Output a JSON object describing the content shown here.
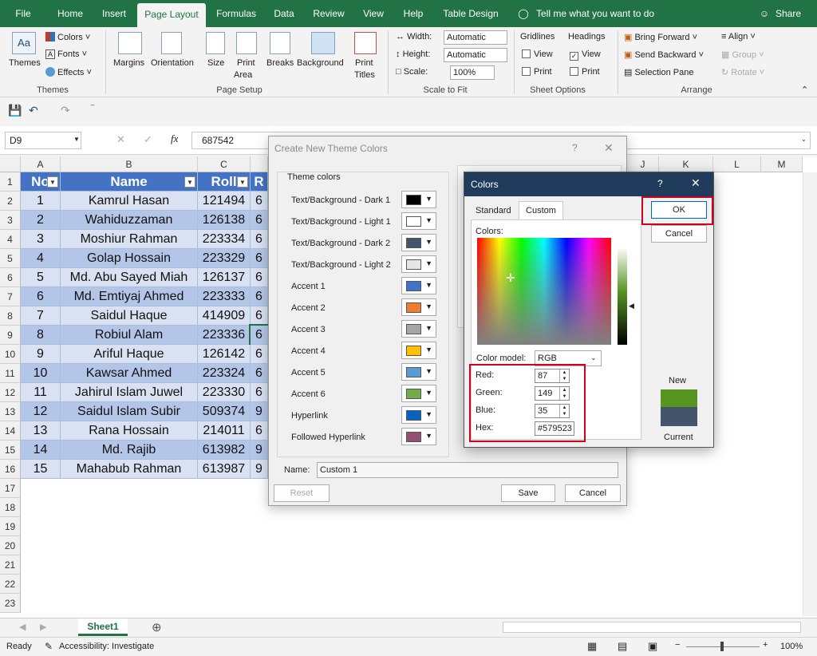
{
  "tabs": [
    {
      "label": "File"
    },
    {
      "label": "Home"
    },
    {
      "label": "Insert"
    },
    {
      "label": "Page Layout"
    },
    {
      "label": "Formulas"
    },
    {
      "label": "Data"
    },
    {
      "label": "Review"
    },
    {
      "label": "View"
    },
    {
      "label": "Help"
    },
    {
      "label": "Table Design"
    }
  ],
  "tell_me": "Tell me what you want to do",
  "share": "Share",
  "ribbon": {
    "themes": {
      "big": "Themes",
      "colors": "Colors",
      "fonts": "Fonts",
      "effects": "Effects",
      "group": "Themes"
    },
    "page_setup": {
      "margins": "Margins",
      "orientation": "Orientation",
      "size": "Size",
      "print_area_1": "Print",
      "print_area_2": "Area",
      "breaks": "Breaks",
      "background": "Background",
      "print_titles_1": "Print",
      "print_titles_2": "Titles",
      "group": "Page Setup"
    },
    "scale": {
      "width_label": "Width:",
      "width_value": "Automatic",
      "height_label": "Height:",
      "height_value": "Automatic",
      "scale_label": "Scale:",
      "scale_value": "100%",
      "group": "Scale to Fit"
    },
    "sheet_options": {
      "gridlines": "Gridlines",
      "headings": "Headings",
      "view": "View",
      "print": "Print",
      "group": "Sheet Options"
    },
    "arrange": {
      "bring_forward": "Bring Forward",
      "send_backward": "Send Backward",
      "selection_pane": "Selection Pane",
      "align": "Align",
      "group_btn": "Group",
      "rotate": "Rotate",
      "group": "Arrange"
    }
  },
  "formula_bar": {
    "name_box": "D9",
    "fx": "fx",
    "value": "687542"
  },
  "columns": [
    "A",
    "B",
    "C",
    "J",
    "K",
    "L",
    "M"
  ],
  "rows": [
    "1",
    "2",
    "3",
    "4",
    "5",
    "6",
    "7",
    "8",
    "9",
    "10",
    "11",
    "12",
    "13",
    "14",
    "15",
    "16",
    "17",
    "18",
    "19",
    "20",
    "21",
    "22",
    "23"
  ],
  "table": {
    "headers": [
      "No",
      "Name",
      "Roll",
      "R"
    ],
    "rows": [
      [
        "1",
        "Kamrul Hasan",
        "121494"
      ],
      [
        "2",
        "Wahiduzzaman",
        "126138"
      ],
      [
        "3",
        "Moshiur Rahman",
        "223334"
      ],
      [
        "4",
        "Golap Hossain",
        "223329"
      ],
      [
        "5",
        "Md. Abu Sayed Miah",
        "126137"
      ],
      [
        "6",
        "Md. Emtiyaj Ahmed",
        "223333"
      ],
      [
        "7",
        "Saidul Haque",
        "414909"
      ],
      [
        "8",
        "Robiul Alam",
        "223336"
      ],
      [
        "9",
        "Ariful Haque",
        "126142"
      ],
      [
        "10",
        "Kawsar Ahmed",
        "223324"
      ],
      [
        "11",
        "Jahirul Islam Juwel",
        "223330"
      ],
      [
        "12",
        "Saidul Islam Subir",
        "509374"
      ],
      [
        "13",
        "Rana Hossain",
        "214011"
      ],
      [
        "14",
        "Md. Rajib",
        "613982"
      ],
      [
        "15",
        "Mahabub Rahman",
        "613987"
      ]
    ],
    "col_d_partial": [
      "6",
      "6",
      "6",
      "6",
      "6",
      "6",
      "6",
      "6",
      "6",
      "6",
      "6",
      "9",
      "6",
      "9",
      "9"
    ]
  },
  "sheet_tab": "Sheet1",
  "status": {
    "ready": "Ready",
    "accessibility": "Accessibility: Investigate",
    "zoom": "100%"
  },
  "theme_dialog": {
    "title": "Create New Theme Colors",
    "help": "?",
    "group_label": "Theme colors",
    "items": [
      {
        "label": "Text/Background - Dark 1",
        "color": "#000000"
      },
      {
        "label": "Text/Background - Light 1",
        "color": "#ffffff"
      },
      {
        "label": "Text/Background - Dark 2",
        "color": "#44546a"
      },
      {
        "label": "Text/Background - Light 2",
        "color": "#e7e6e6"
      },
      {
        "label": "Accent 1",
        "color": "#4472c4"
      },
      {
        "label": "Accent 2",
        "color": "#ed7d31"
      },
      {
        "label": "Accent 3",
        "color": "#a5a5a5"
      },
      {
        "label": "Accent 4",
        "color": "#ffc000"
      },
      {
        "label": "Accent 5",
        "color": "#5b9bd5"
      },
      {
        "label": "Accent 6",
        "color": "#70ad47"
      },
      {
        "label": "Hyperlink",
        "color": "#0563c1"
      },
      {
        "label": "Followed Hyperlink",
        "color": "#954f72"
      }
    ],
    "name_label": "Name:",
    "name_value": "Custom 1",
    "reset": "Reset",
    "save": "Save",
    "cancel": "Cancel"
  },
  "colors_dialog": {
    "title": "Colors",
    "help": "?",
    "tab_standard": "Standard",
    "tab_custom": "Custom",
    "colors_label": "Colors:",
    "model_label": "Color model:",
    "model_value": "RGB",
    "red_label": "Red:",
    "red": "87",
    "green_label": "Green:",
    "green": "149",
    "blue_label": "Blue:",
    "blue": "35",
    "hex_label": "Hex:",
    "hex": "#579523",
    "ok": "OK",
    "cancel": "Cancel",
    "new_label": "New",
    "current_label": "Current",
    "new_color": "#579523",
    "current_color": "#44546a"
  }
}
